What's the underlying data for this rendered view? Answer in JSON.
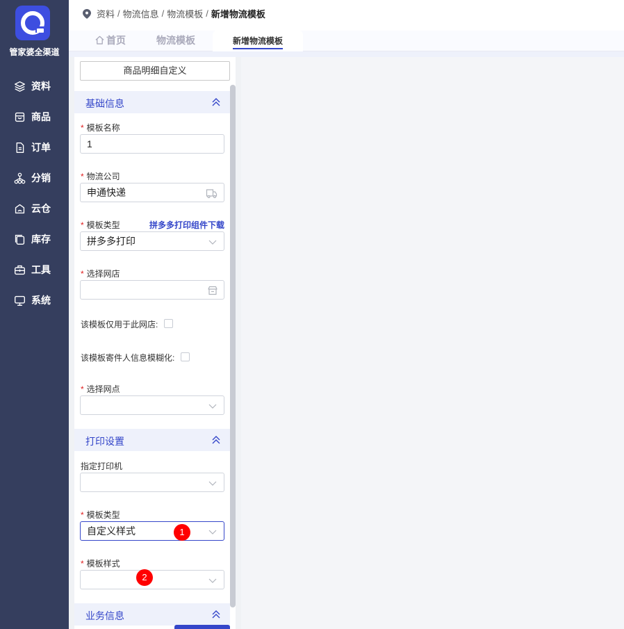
{
  "sidebar": {
    "brand": "管家婆全渠道",
    "items": [
      {
        "label": "资料",
        "icon": "layers-icon"
      },
      {
        "label": "商品",
        "icon": "store-icon"
      },
      {
        "label": "订单",
        "icon": "document-icon"
      },
      {
        "label": "分销",
        "icon": "network-icon"
      },
      {
        "label": "云仓",
        "icon": "cloud-warehouse-icon"
      },
      {
        "label": "库存",
        "icon": "inventory-icon"
      },
      {
        "label": "工具",
        "icon": "toolbox-icon"
      },
      {
        "label": "系统",
        "icon": "monitor-icon"
      }
    ]
  },
  "breadcrumb": {
    "items": [
      "资料",
      "物流信息",
      "物流模板"
    ],
    "current": "新增物流模板",
    "separator": "/"
  },
  "tabs": {
    "home": "首页",
    "logistics": "物流模板",
    "new": "新增物流模板"
  },
  "panel": {
    "custom_button": "商品明细自定义",
    "basic": {
      "title": "基础信息",
      "template_name_label": "模板名称",
      "template_name_value": "1",
      "company_label": "物流公司",
      "company_value": "申通快递",
      "type_label": "模板类型",
      "type_link": "拼多多打印组件下载",
      "type_value": "拼多多打印",
      "shop_label": "选择网店",
      "only_shop_label": "该模板仅用于此网店:",
      "blur_sender_label": "该模板寄件人信息模糊化:",
      "outlet_label": "选择网点"
    },
    "print": {
      "title": "打印设置",
      "printer_label": "指定打印机",
      "type_label": "模板类型",
      "type_value": "自定义样式",
      "style_label": "模板样式"
    },
    "business": {
      "title": "业务信息"
    }
  },
  "annotations": [
    "1",
    "2"
  ],
  "colors": {
    "sidebar": "#353e5e",
    "accent": "#3446c9",
    "required": "#e02020",
    "badge": "#ff0000"
  }
}
